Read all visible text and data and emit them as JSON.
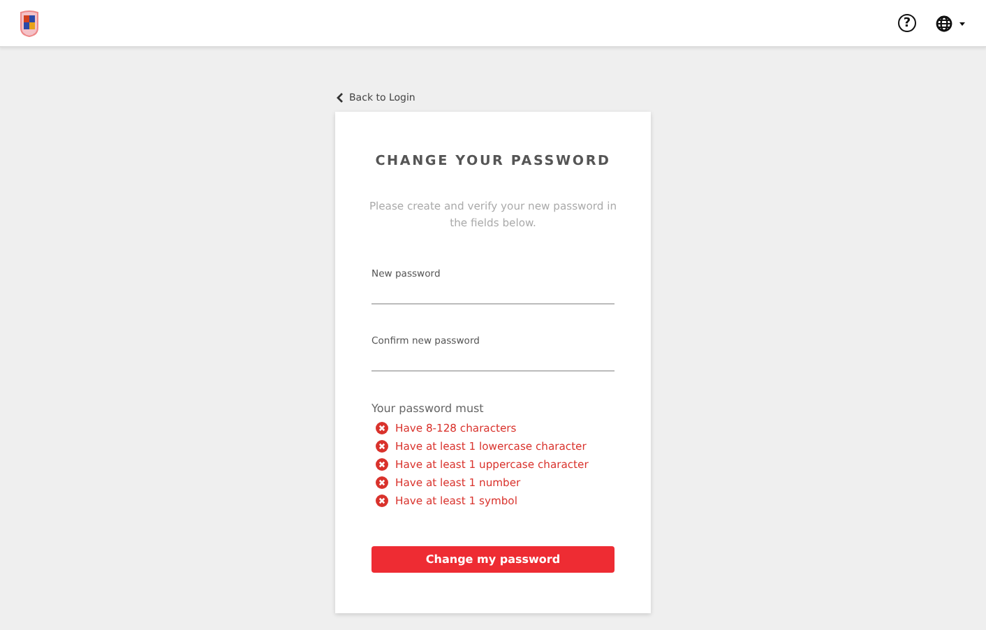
{
  "header": {
    "help_label": "?"
  },
  "back_link": "Back to Login",
  "card": {
    "title": "CHANGE YOUR PASSWORD",
    "intro": "Please create and verify your new password in the fields below.",
    "fields": [
      {
        "label": "New password"
      },
      {
        "label": "Confirm new password"
      }
    ],
    "rules_heading": "Your password must",
    "rules": [
      {
        "text": "Have 8-128 characters",
        "met": false
      },
      {
        "text": "Have at least 1 lowercase character",
        "met": false
      },
      {
        "text": "Have at least 1 uppercase character",
        "met": false
      },
      {
        "text": "Have at least 1 number",
        "met": false
      },
      {
        "text": "Have at least 1 symbol",
        "met": false
      }
    ],
    "submit": "Change my password"
  }
}
